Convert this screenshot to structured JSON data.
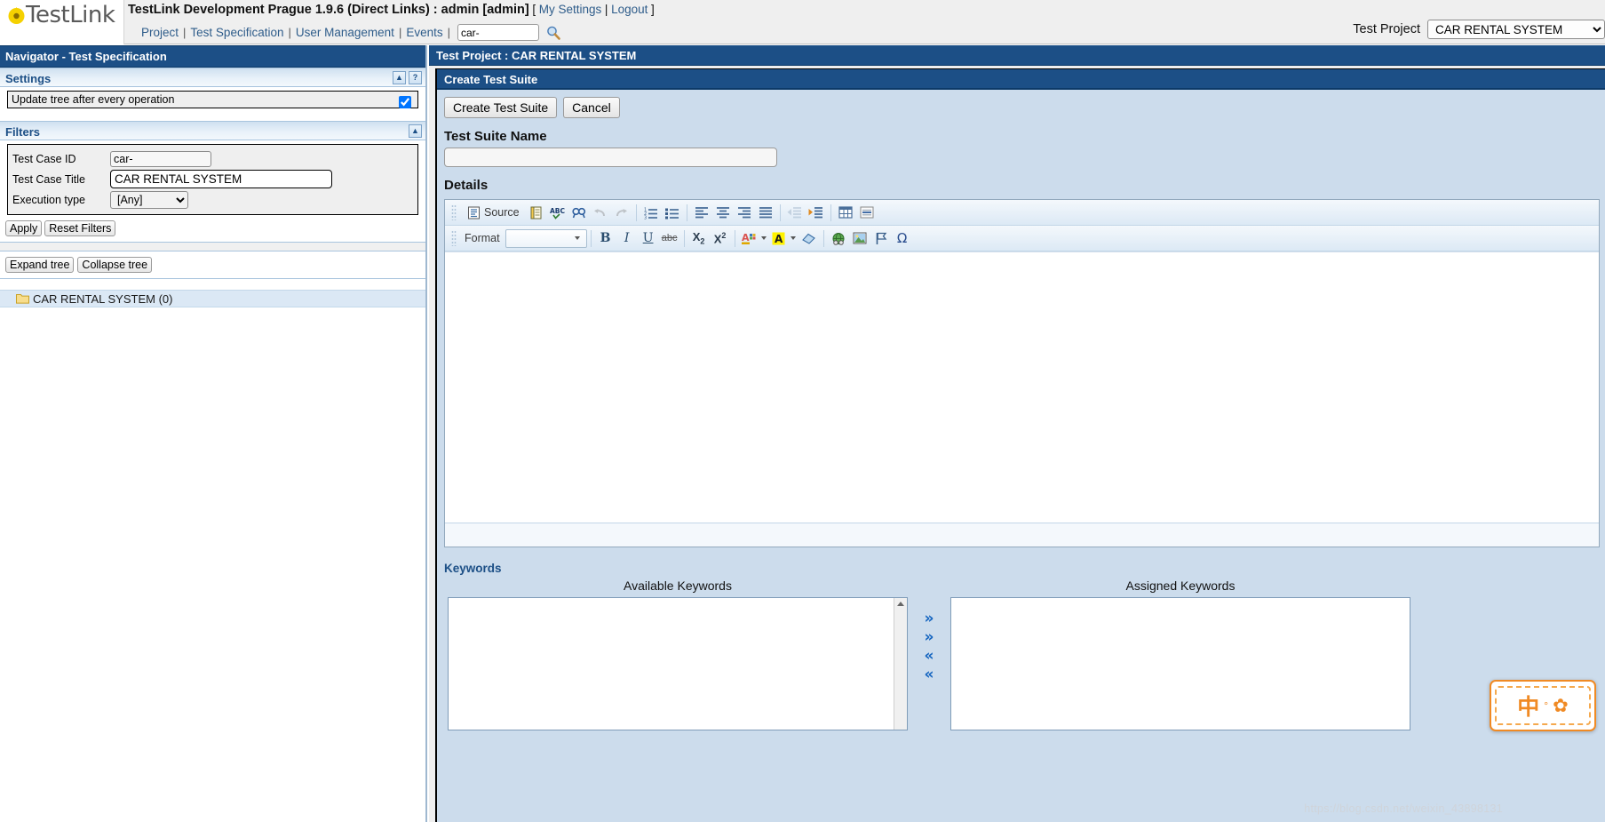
{
  "header": {
    "logo_text": "TestLink",
    "app_title": "TestLink Development Prague 1.9.6 (Direct Links) : admin [admin]",
    "bracket_open": "[",
    "bracket_close": "]",
    "my_settings": "My Settings",
    "pipe": "|",
    "logout": "Logout",
    "menu": [
      {
        "label": "Project"
      },
      {
        "label": "Test Specification"
      },
      {
        "label": "User Management"
      },
      {
        "label": "Events"
      }
    ],
    "search_value": "car-",
    "search_placeholder": "",
    "search_icon": "magnifier-icon",
    "project_label": "Test Project",
    "project_selected": "CAR RENTAL SYSTEM"
  },
  "navigator": {
    "title": "Navigator - Test Specification",
    "settings": {
      "heading": "Settings",
      "collapse_icon": "▲",
      "help_icon": "?",
      "option_label": "Update tree after every operation",
      "option_checked": true
    },
    "filters": {
      "heading": "Filters",
      "collapse_icon": "▲",
      "rows": [
        {
          "label": "Test Case ID",
          "value": "car-"
        },
        {
          "label": "Test Case Title",
          "value": "CAR RENTAL SYSTEM"
        },
        {
          "label": "Execution type",
          "value": "[Any]"
        }
      ],
      "apply_label": "Apply",
      "reset_label": "Reset Filters"
    },
    "tree": {
      "expand_label": "Expand tree",
      "collapse_label": "Collapse tree",
      "root_label": "CAR RENTAL SYSTEM (0)",
      "root_icon": "folder-icon"
    }
  },
  "main": {
    "project_bar": "Test Project : CAR RENTAL SYSTEM",
    "panel_title": "Create Test Suite",
    "create_button": "Create Test Suite",
    "cancel_button": "Cancel",
    "suite_name_heading": "Test Suite Name",
    "suite_name_value": "",
    "suite_name_placeholder": "",
    "details_heading": "Details",
    "editor": {
      "source_label": "Source",
      "format_label": "Format",
      "format_value": "",
      "toolbar_row1": [
        {
          "name": "source-icon",
          "glyph": "▤"
        },
        {
          "name": "templates-icon",
          "glyph": "▥"
        },
        {
          "name": "spellcheck-icon",
          "glyph": "ABC"
        },
        {
          "name": "find-replace-icon",
          "glyph": "Ж"
        },
        {
          "name": "undo-icon",
          "glyph": "↶"
        },
        {
          "name": "redo-icon",
          "glyph": "↷"
        },
        {
          "name": "numbered-list-icon",
          "glyph": "1≡"
        },
        {
          "name": "bulleted-list-icon",
          "glyph": "☰"
        },
        {
          "name": "align-left-icon",
          "glyph": "≡"
        },
        {
          "name": "align-center-icon",
          "glyph": "≡"
        },
        {
          "name": "align-right-icon",
          "glyph": "≡"
        },
        {
          "name": "align-justify-icon",
          "glyph": "≡"
        },
        {
          "name": "outdent-icon",
          "glyph": "⇤"
        },
        {
          "name": "indent-icon",
          "glyph": "⇥"
        },
        {
          "name": "table-icon",
          "glyph": "▦"
        },
        {
          "name": "horizontal-rule-icon",
          "glyph": "—"
        }
      ],
      "toolbar_row2": [
        {
          "name": "bold-icon",
          "glyph": "B"
        },
        {
          "name": "italic-icon",
          "glyph": "I"
        },
        {
          "name": "underline-icon",
          "glyph": "U"
        },
        {
          "name": "strikethrough-icon",
          "glyph": "abc"
        },
        {
          "name": "subscript-icon",
          "glyph": "X₂"
        },
        {
          "name": "superscript-icon",
          "glyph": "X²"
        },
        {
          "name": "text-color-icon",
          "glyph": "A"
        },
        {
          "name": "background-color-icon",
          "glyph": "A"
        },
        {
          "name": "remove-format-icon",
          "glyph": "▱"
        },
        {
          "name": "link-icon",
          "glyph": "⊕"
        },
        {
          "name": "image-icon",
          "glyph": "⛰"
        },
        {
          "name": "anchor-icon",
          "glyph": "⚑"
        },
        {
          "name": "special-char-icon",
          "glyph": "Ω"
        }
      ],
      "body_value": ""
    },
    "keywords": {
      "heading": "Keywords",
      "available_title": "Available Keywords",
      "assigned_title": "Assigned Keywords",
      "available_items": [],
      "assigned_items": [],
      "arrow_add": "»",
      "arrow_add_all": "»",
      "arrow_remove": "«",
      "arrow_remove_all": "«"
    }
  },
  "overlay": {
    "ime_text": "中",
    "ime_dot": "°",
    "ime_flower": "✿",
    "watermark": "https://blog.csdn.net/weixin_43898131"
  },
  "colors": {
    "title_bar": "#1c4f86",
    "panel_bg": "#ccdcec",
    "link": "#2e5c8a",
    "accent_orange": "#f08a24"
  }
}
